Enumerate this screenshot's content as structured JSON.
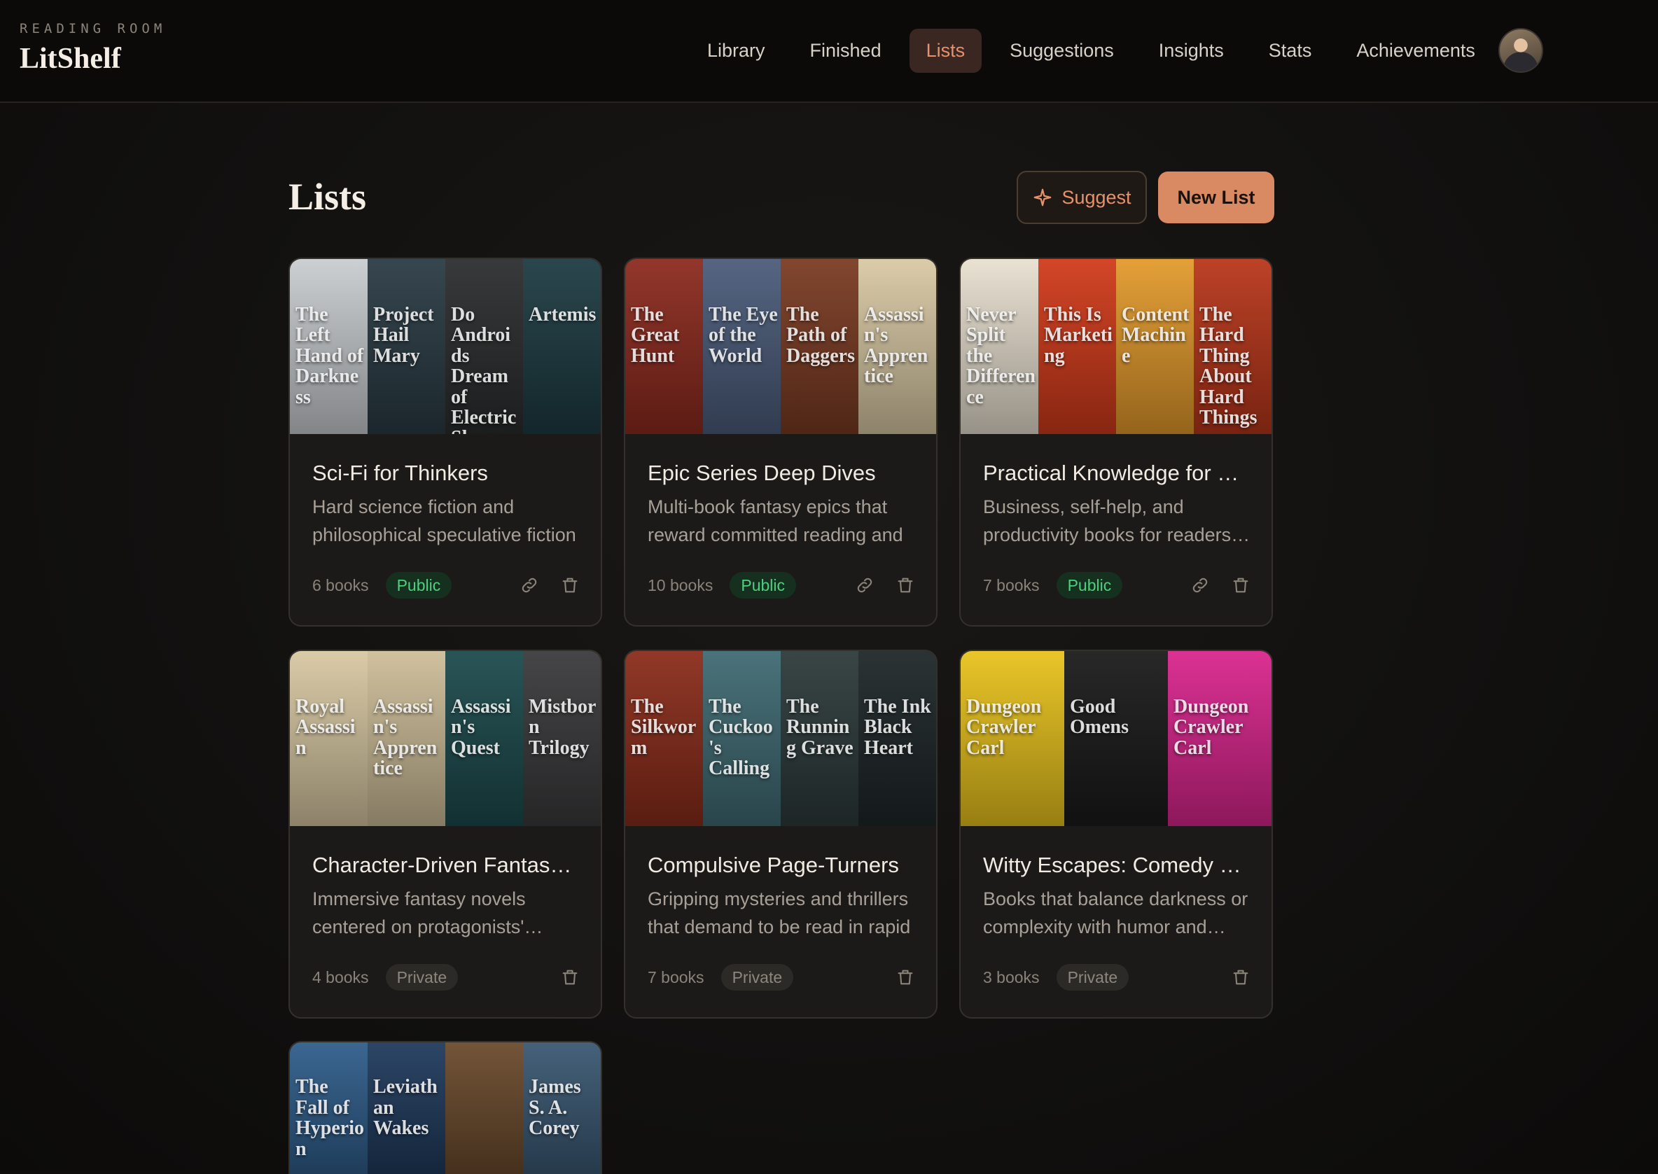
{
  "brand": {
    "kicker": "READING ROOM",
    "title": "LitShelf"
  },
  "nav": {
    "items": [
      {
        "label": "Library"
      },
      {
        "label": "Finished"
      },
      {
        "label": "Lists",
        "active": true
      },
      {
        "label": "Suggestions"
      },
      {
        "label": "Insights"
      },
      {
        "label": "Stats"
      },
      {
        "label": "Achievements"
      }
    ]
  },
  "page": {
    "title": "Lists",
    "suggest_label": "Suggest",
    "new_list_label": "New List"
  },
  "lists": [
    {
      "title": "Sci-Fi for Thinkers",
      "description": "Hard science fiction and philosophical speculative fiction",
      "count": "6 books",
      "visibility": "Public",
      "covers": [
        {
          "label": "The Left Hand of Darkness",
          "color": "#c9cdd0"
        },
        {
          "label": "Project Hail Mary",
          "color": "#2a3b44"
        },
        {
          "label": "Do Androids Dream of Electric Sheep",
          "color": "#2b2d2e"
        },
        {
          "label": "Artemis",
          "color": "#1d3b42"
        }
      ]
    },
    {
      "title": "Epic Series Deep Dives",
      "description": "Multi-book fantasy epics that reward committed reading and",
      "count": "10 books",
      "visibility": "Public",
      "covers": [
        {
          "label": "The Great Hunt",
          "color": "#8c2a1e"
        },
        {
          "label": "The Eye of the World",
          "color": "#4b5c7a"
        },
        {
          "label": "The Path of Daggers",
          "color": "#7a3b22"
        },
        {
          "label": "Assassin's Apprentice",
          "color": "#d9c9a4"
        }
      ]
    },
    {
      "title": "Practical Knowledge for Builders",
      "description": "Business, self-help, and productivity books for readers who",
      "count": "7 books",
      "visibility": "Public",
      "covers": [
        {
          "label": "Never Split the Difference",
          "color": "#e8e0d0"
        },
        {
          "label": "This Is Marketing",
          "color": "#d13a1a"
        },
        {
          "label": "Content Machine",
          "color": "#e39a2c"
        },
        {
          "label": "The Hard Thing About Hard Things",
          "color": "#b8361a"
        }
      ]
    },
    {
      "title": "Character-Driven Fantasy Favorites",
      "description": "Immersive fantasy novels centered on protagonists' journeys",
      "count": "4 books",
      "visibility": "Private",
      "covers": [
        {
          "label": "Royal Assassin",
          "color": "#d8c8a2"
        },
        {
          "label": "Assassin's Apprentice",
          "color": "#cdbd98"
        },
        {
          "label": "Assassin's Quest",
          "color": "#1c4a4c"
        },
        {
          "label": "Mistborn Trilogy",
          "color": "#3a3a3c"
        }
      ]
    },
    {
      "title": "Compulsive Page-Turners",
      "description": "Gripping mysteries and thrillers that demand to be read in rapid",
      "count": "7 books",
      "visibility": "Private",
      "covers": [
        {
          "label": "The Silkworm",
          "color": "#8a2c1a"
        },
        {
          "label": "The Cuckoo's Calling",
          "color": "#3f6a72"
        },
        {
          "label": "The Running Grave",
          "color": "#2d3a3a"
        },
        {
          "label": "The Ink Black Heart",
          "color": "#1e2628"
        }
      ]
    },
    {
      "title": "Witty Escapes: Comedy & Adventure",
      "description": "Books that balance darkness or complexity with humor and heart",
      "count": "3 books",
      "visibility": "Private",
      "covers": [
        {
          "label": "Dungeon Crawler Carl",
          "color": "#e8c21c"
        },
        {
          "label": "Good Omens",
          "color": "#1a1a1a"
        },
        {
          "label": "Dungeon Crawler Carl",
          "color": "#d9258c"
        }
      ]
    },
    {
      "title": "",
      "description": "",
      "count": "",
      "visibility": "",
      "covers": [
        {
          "label": "The Fall of Hyperion",
          "color": "#2f5d8a"
        },
        {
          "label": "Leviathan Wakes",
          "color": "#1f3a5c"
        },
        {
          "label": "",
          "color": "#6a4a2c"
        },
        {
          "label": "James S. A. Corey",
          "color": "#3a5872"
        }
      ]
    }
  ],
  "colors": {
    "accent": "#e8916a",
    "button_primary": "#d98a62",
    "public_badge": "#4fcf7e",
    "background": "#0f0e0d"
  },
  "icons": {
    "suggest": "sparkle-icon",
    "share": "link-icon",
    "delete": "trash-icon"
  }
}
